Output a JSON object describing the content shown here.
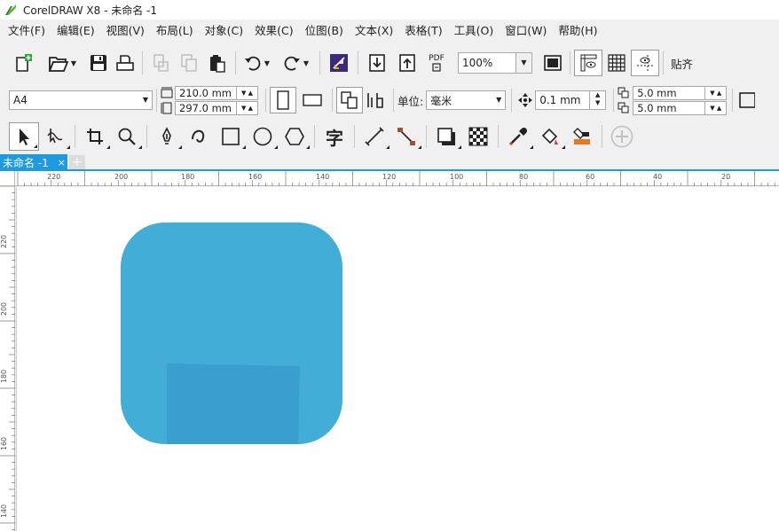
{
  "window": {
    "title": "CorelDRAW X8 - 未命名 -1"
  },
  "menu": [
    "文件(F)",
    "编辑(E)",
    "视图(V)",
    "布局(L)",
    "对象(C)",
    "效果(C)",
    "位图(B)",
    "文本(X)",
    "表格(T)",
    "工具(O)",
    "窗口(W)",
    "帮助(H)"
  ],
  "standard_toolbar": {
    "zoom_value": "100%",
    "snap_label": "贴齐",
    "pdf_label": "PDF"
  },
  "property_bar": {
    "page_size": "A4",
    "width": "210.0 mm",
    "height": "297.0 mm",
    "units_label": "单位:",
    "units_value": "毫米",
    "nudge": "0.1 mm",
    "dup_x": "5.0 mm",
    "dup_y": "5.0 mm"
  },
  "toolbox_labels": {
    "text_tool": "字"
  },
  "document_tab": {
    "name": "未命名 -1",
    "close": "×",
    "add": "+"
  },
  "ruler": {
    "h_labels": [
      "220",
      "200",
      "180",
      "160",
      "140",
      "120",
      "100",
      "80",
      "60",
      "40",
      "20"
    ],
    "v_labels": [
      "220",
      "200",
      "180",
      "160",
      "140"
    ]
  },
  "colors": {
    "shape_fill": "#42ADD6",
    "shape_inner": "#3A9FCE",
    "accent": "#1E9AE0"
  }
}
